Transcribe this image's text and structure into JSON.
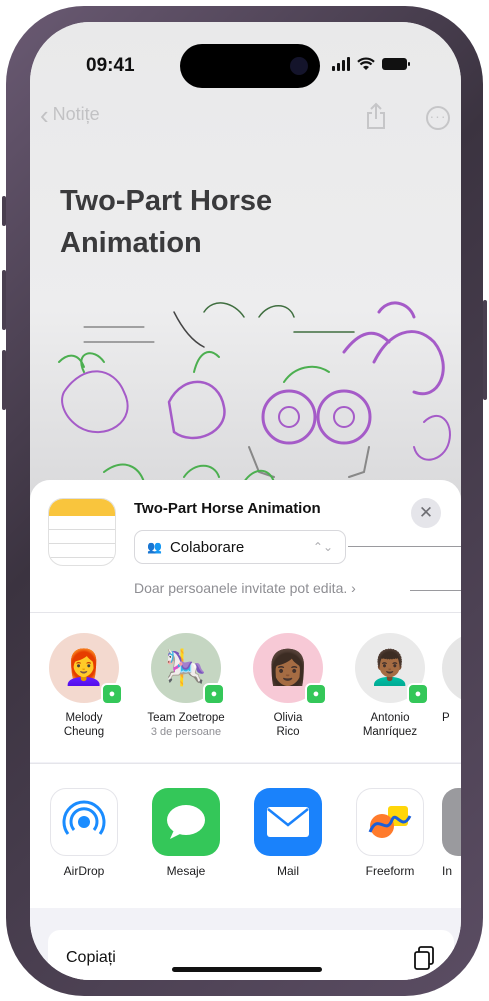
{
  "status_bar": {
    "time": "09:41"
  },
  "nav": {
    "back_label": "Notițe",
    "back_chevron": "‹",
    "more_glyph": "···"
  },
  "note": {
    "title": "Two-Part Horse Animation"
  },
  "share_sheet": {
    "title": "Two-Part Horse Animation",
    "close_glyph": "✕",
    "collaboration": {
      "selected": "Colaborare",
      "people_glyph": "👥",
      "updown_glyph": "⌃⌄"
    },
    "permission_text": "Doar persoanele invitate pot edita.",
    "permission_chevron": "›",
    "people": [
      {
        "name": "Melody\nCheung",
        "line1": "Melody",
        "line2": "Cheung",
        "sub": "",
        "avatar_icon": "memoji-woman-glasses-icon",
        "avatar_bg": "#f3d9cf",
        "glyph": "👩‍🦰"
      },
      {
        "name": "Team Zoetrope",
        "line1": "Team Zoetrope",
        "line2": "",
        "sub": "3 de persoane",
        "avatar_icon": "group-photo-icon",
        "avatar_bg": "#c5d6c2",
        "glyph": "🎠"
      },
      {
        "name": "Olivia\nRico",
        "line1": "Olivia",
        "line2": "Rico",
        "sub": "",
        "avatar_icon": "memoji-woman-icon",
        "avatar_bg": "#f7c9d6",
        "glyph": "👩🏾"
      },
      {
        "name": "Antonio\nManríquez",
        "line1": "Antonio",
        "line2": "Manríquez",
        "sub": "",
        "avatar_icon": "memoji-man-icon",
        "avatar_bg": "#eaeaea",
        "glyph": "👨🏾‍🦱"
      },
      {
        "name": "P",
        "line1": "P",
        "line2": "",
        "sub": "",
        "avatar_icon": "partial-avatar-icon",
        "avatar_bg": "#e6e6e6",
        "glyph": ""
      }
    ],
    "apps": [
      {
        "label": "AirDrop",
        "icon": "airdrop-icon",
        "bg": "#ffffff",
        "glyph": "◎",
        "color": "#1a8cff"
      },
      {
        "label": "Mesaje",
        "icon": "messages-icon",
        "bg": "#34c759",
        "glyph": "💬",
        "color": "#ffffff"
      },
      {
        "label": "Mail",
        "icon": "mail-icon",
        "bg": "#1a82fb",
        "glyph": "✉",
        "color": "#ffffff"
      },
      {
        "label": "Freeform",
        "icon": "freeform-icon",
        "bg": "#ffffff",
        "glyph": "〰",
        "color": "#1a5fd9"
      },
      {
        "label": "In",
        "icon": "partial-app-icon",
        "bg": "#9a9a9e",
        "glyph": "",
        "color": "#ffffff"
      }
    ],
    "copy_label": "Copiați"
  },
  "colors": {
    "accent_green": "#34c759",
    "notes_yellow": "#f9c53d",
    "sheet_bg": "#f2f2f7"
  }
}
